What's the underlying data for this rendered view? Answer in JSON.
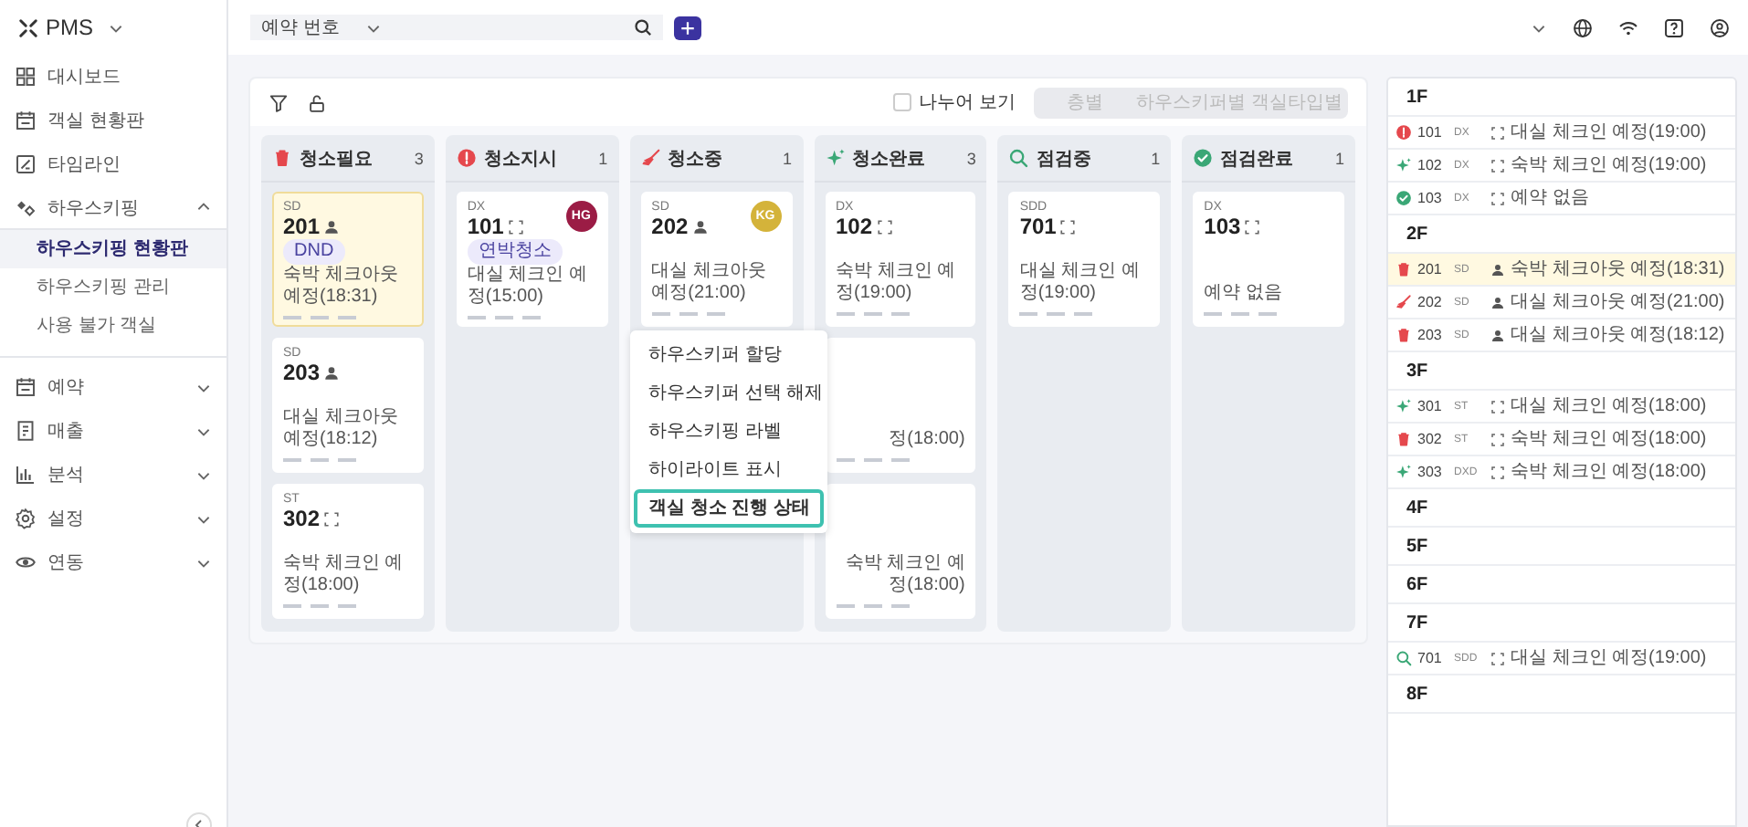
{
  "app": {
    "name": "PMS"
  },
  "sidebar": {
    "items": [
      {
        "kind": "link",
        "label": "대시보드"
      },
      {
        "kind": "link",
        "label": "객실 현황판"
      },
      {
        "kind": "link",
        "label": "타임라인"
      },
      {
        "kind": "group",
        "label": "하우스키핑",
        "expanded": true,
        "children": [
          {
            "label": "하우스키핑 현황판",
            "selected": true
          },
          {
            "label": "하우스키핑 관리",
            "selected": false
          },
          {
            "label": "사용 불가 객실",
            "selected": false
          }
        ]
      },
      {
        "kind": "group",
        "label": "예약",
        "expanded": false
      },
      {
        "kind": "group",
        "label": "매출",
        "expanded": false
      },
      {
        "kind": "group",
        "label": "분석",
        "expanded": false
      },
      {
        "kind": "group",
        "label": "설정",
        "expanded": false
      },
      {
        "kind": "group",
        "label": "연동",
        "expanded": false
      }
    ]
  },
  "search": {
    "field": "예약 번호"
  },
  "toolbar": {
    "split_view": {
      "label": "나누어 보기",
      "checked": false
    },
    "view_modes": [
      {
        "label": "층별",
        "selected": false
      },
      {
        "label": "하우스키퍼별",
        "selected": false
      },
      {
        "label": "객실타입별",
        "selected": false
      }
    ]
  },
  "columns": [
    {
      "title": "청소필요",
      "kind": "dirty",
      "count": "3",
      "cards": [
        {
          "type": "SD",
          "room": "201",
          "occupied": true,
          "tag": "DND",
          "note": "숙박 체크아웃 예정(18:31)",
          "highlighted": true
        },
        {
          "type": "SD",
          "room": "203",
          "occupied": true,
          "note": "대실 체크아웃 예정(18:12)",
          "highlighted": false
        },
        {
          "type": "ST",
          "room": "302",
          "occupied": false,
          "note": "숙박 체크인 예정(18:00)",
          "highlighted": false
        }
      ]
    },
    {
      "title": "청소지시",
      "kind": "ordered",
      "count": "1",
      "cards": [
        {
          "type": "DX",
          "room": "101",
          "occupied": false,
          "tag": "연박청소",
          "assignee": {
            "initials": "HG",
            "color": "#9b1c45"
          },
          "note": "대실 체크인 예정(15:00)",
          "highlighted": false
        }
      ]
    },
    {
      "title": "청소중",
      "kind": "cleaning",
      "count": "1",
      "cards": [
        {
          "type": "SD",
          "room": "202",
          "occupied": true,
          "assignee": {
            "initials": "KG",
            "color": "#d4b33a"
          },
          "note": "대실 체크아웃 예정(21:00)",
          "highlighted": false
        }
      ]
    },
    {
      "title": "청소완료",
      "kind": "cleaned",
      "count": "3",
      "cards": [
        {
          "type": "DX",
          "room": "102",
          "occupied": false,
          "note": "숙박 체크인 예정(19:00)",
          "highlighted": false
        },
        {
          "kind": "covered",
          "note": "정(18:00)",
          "highlighted": false
        },
        {
          "kind": "covered",
          "note": "숙박 체크인 예정(18:00)",
          "highlighted": false
        }
      ]
    },
    {
      "title": "점검중",
      "kind": "inspecting",
      "count": "1",
      "cards": [
        {
          "type": "SDD",
          "room": "701",
          "occupied": false,
          "note": "대실 체크인 예정(19:00)",
          "highlighted": false
        }
      ]
    },
    {
      "title": "점검완료",
      "kind": "inspected",
      "count": "1",
      "cards": [
        {
          "type": "DX",
          "room": "103",
          "occupied": false,
          "note": "예약 없음",
          "highlighted": false
        }
      ]
    }
  ],
  "context_menu": {
    "items": [
      {
        "label": "하우스키퍼 할당",
        "selected": false
      },
      {
        "label": "하우스키퍼 선택 해제",
        "selected": false
      },
      {
        "label": "하우스키핑 라벨",
        "selected": false
      },
      {
        "label": "하이라이트 표시",
        "selected": false
      },
      {
        "label": "객실 청소 진행 상태",
        "selected": true
      }
    ]
  },
  "floor_panel": {
    "floors": [
      {
        "label": "1F",
        "rooms": [
          {
            "kind": "ordered",
            "room": "101",
            "type": "DX",
            "occupied": false,
            "note": "대실 체크인 예정(19:00)",
            "highlighted": false
          },
          {
            "kind": "cleaned",
            "room": "102",
            "type": "DX",
            "occupied": false,
            "note": "숙박 체크인 예정(19:00)",
            "highlighted": false
          },
          {
            "kind": "inspected",
            "room": "103",
            "type": "DX",
            "occupied": false,
            "note": "예약 없음",
            "highlighted": false
          }
        ]
      },
      {
        "label": "2F",
        "rooms": [
          {
            "kind": "dirty",
            "room": "201",
            "type": "SD",
            "occupied": true,
            "note": "숙박 체크아웃 예정(18:31)",
            "highlighted": true
          },
          {
            "kind": "cleaning",
            "room": "202",
            "type": "SD",
            "occupied": true,
            "note": "대실 체크아웃 예정(21:00)",
            "highlighted": false
          },
          {
            "kind": "dirty",
            "room": "203",
            "type": "SD",
            "occupied": true,
            "note": "대실 체크아웃 예정(18:12)",
            "highlighted": false
          }
        ]
      },
      {
        "label": "3F",
        "rooms": [
          {
            "kind": "cleaned",
            "room": "301",
            "type": "ST",
            "occupied": false,
            "note": "대실 체크인 예정(18:00)",
            "highlighted": false
          },
          {
            "kind": "dirty",
            "room": "302",
            "type": "ST",
            "occupied": false,
            "note": "숙박 체크인 예정(18:00)",
            "highlighted": false
          },
          {
            "kind": "cleaned",
            "room": "303",
            "type": "DXD",
            "occupied": false,
            "note": "숙박 체크인 예정(18:00)",
            "highlighted": false
          }
        ]
      },
      {
        "label": "4F"
      },
      {
        "label": "5F"
      },
      {
        "label": "6F"
      },
      {
        "label": "7F",
        "rooms": [
          {
            "kind": "inspecting",
            "room": "701",
            "type": "SDD",
            "occupied": false,
            "note": "대실 체크인 예정(19:00)",
            "highlighted": false
          }
        ]
      },
      {
        "label": "8F"
      }
    ]
  }
}
